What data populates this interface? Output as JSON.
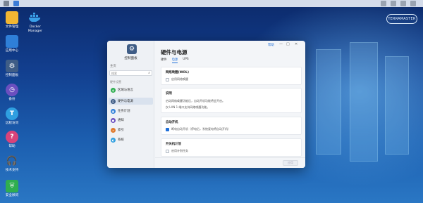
{
  "desktop": {
    "icons": [
      {
        "label": "文件管理",
        "icon": "folder-icon",
        "color": "#f2b632"
      },
      {
        "label": "Docker\nManager",
        "icon": "docker-icon",
        "color": "#2f8fd8"
      },
      {
        "label": "应用中心",
        "icon": "app-center-icon",
        "color": "#2f7fd8"
      },
      {
        "label": "控制面板",
        "icon": "control-panel-icon",
        "color": "#3f5d86"
      },
      {
        "label": "备份",
        "icon": "backup-icon",
        "color": "#6b4fbf"
      },
      {
        "label": "远程访问",
        "icon": "remote-access-icon",
        "color": "#2f9fe0"
      },
      {
        "label": "帮助",
        "icon": "help-icon",
        "color": "#d8437a"
      },
      {
        "label": "技术支持",
        "icon": "support-icon",
        "color": "#1f8ee0"
      },
      {
        "label": "安全顾问",
        "icon": "security-advisor-icon",
        "color": "#2fae4f"
      }
    ],
    "brand": "TERRAMASTER"
  },
  "window": {
    "app_title": "控制面板",
    "breadcrumb": "主页",
    "search_placeholder": "搜索",
    "section_label": "硬件设置",
    "sidebar_items": [
      {
        "label": "区域与语言",
        "color": "#2fae4f"
      },
      {
        "label": "硬件与电源",
        "color": "#3f5d86"
      },
      {
        "label": "任务计划",
        "color": "#2f7fd8"
      },
      {
        "label": "通知",
        "color": "#6b4fbf"
      },
      {
        "label": "索引",
        "color": "#e07b2f"
      },
      {
        "label": "系统",
        "color": "#2f9fe0"
      }
    ],
    "controls": {
      "help": "帮助",
      "minimize": "—",
      "maximize": "□",
      "close": "✕"
    },
    "title": "硬件与电源",
    "tabs": [
      "硬件",
      "电源",
      "UPS"
    ],
    "active_tab": "电源",
    "cards": [
      {
        "header": "网络唤醒(WOL)",
        "lines": [
          {
            "text": "启用网络唤醒",
            "checked": false
          }
        ]
      },
      {
        "header": "说明",
        "lines": [
          {
            "text": "启动网络唤醒功能后，自动开机功能将会开启。"
          },
          {
            "text": "仅 LAN 1 端口支持网络唤醒功能。"
          }
        ]
      },
      {
        "header": "自动开机",
        "lines": [
          {
            "text": "断电自动开机（停电后，系统复电将自动开机）",
            "checked": true
          }
        ]
      },
      {
        "header": "开关机计划",
        "lines": [
          {
            "text": "启用计划任务",
            "checked": false
          }
        ]
      }
    ],
    "apply_label": "应用"
  }
}
